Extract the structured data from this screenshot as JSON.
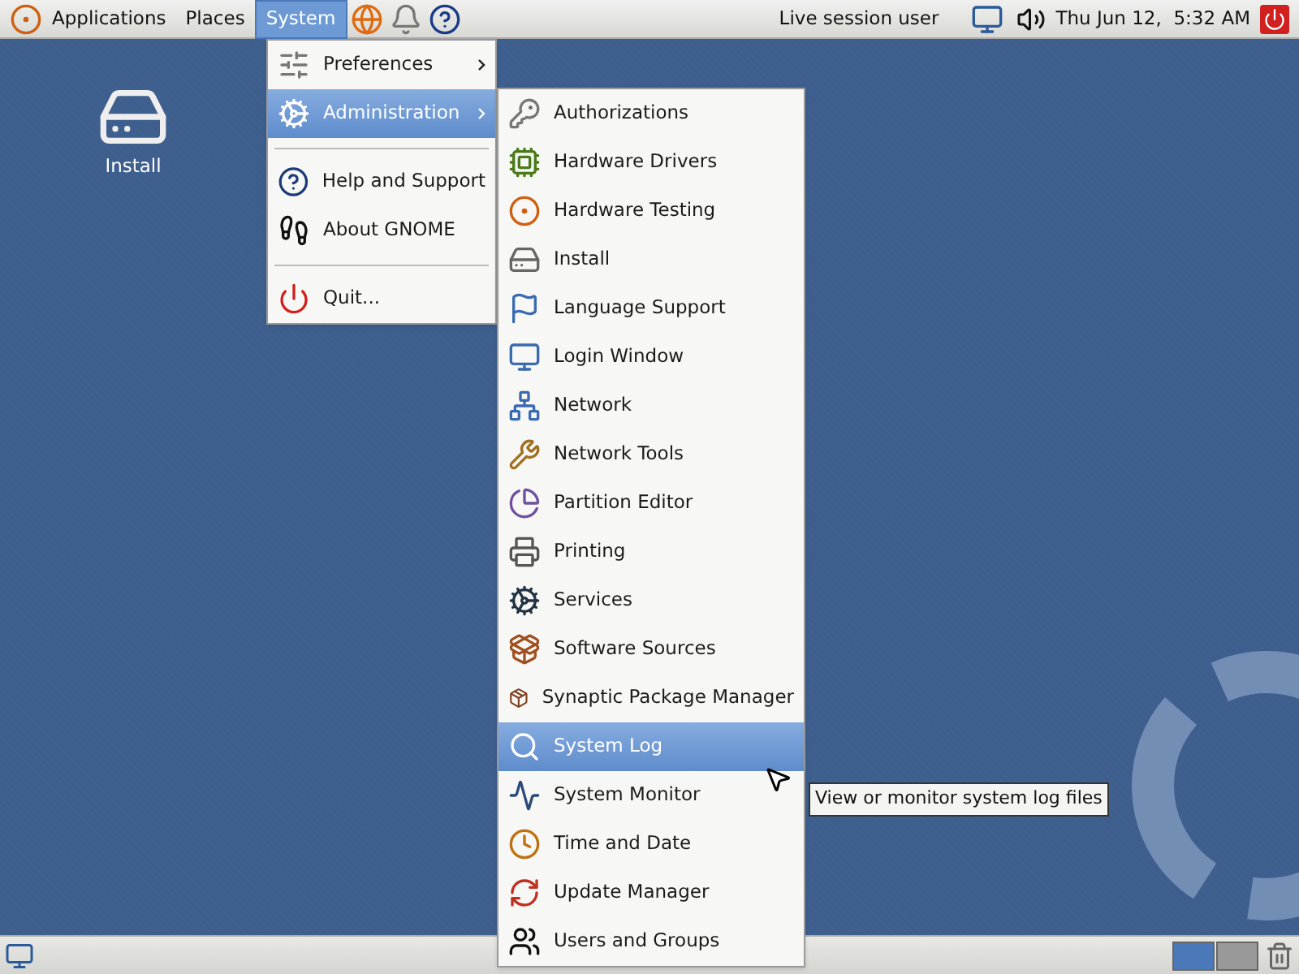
{
  "top_panel": {
    "menus": [
      {
        "label": "Applications",
        "selected": false
      },
      {
        "label": "Places",
        "selected": false
      },
      {
        "label": "System",
        "selected": true
      }
    ],
    "user": "Live session user",
    "clock": "Thu Jun 12,  5:32 AM"
  },
  "desktop_icons": [
    {
      "label": "Install"
    }
  ],
  "system_menu": [
    {
      "kind": "item",
      "label": "Preferences",
      "submenu": true,
      "selected": false
    },
    {
      "kind": "item",
      "label": "Administration",
      "submenu": true,
      "selected": true
    },
    {
      "kind": "separator"
    },
    {
      "kind": "item",
      "label": "Help and Support",
      "submenu": false,
      "selected": false
    },
    {
      "kind": "item",
      "label": "About GNOME",
      "submenu": false,
      "selected": false
    },
    {
      "kind": "separator"
    },
    {
      "kind": "item",
      "label": "Quit...",
      "submenu": false,
      "selected": false
    }
  ],
  "administration_menu": [
    {
      "label": "Authorizations",
      "selected": false
    },
    {
      "label": "Hardware Drivers",
      "selected": false
    },
    {
      "label": "Hardware Testing",
      "selected": false
    },
    {
      "label": "Install",
      "selected": false
    },
    {
      "label": "Language Support",
      "selected": false
    },
    {
      "label": "Login Window",
      "selected": false
    },
    {
      "label": "Network",
      "selected": false
    },
    {
      "label": "Network Tools",
      "selected": false
    },
    {
      "label": "Partition Editor",
      "selected": false
    },
    {
      "label": "Printing",
      "selected": false
    },
    {
      "label": "Services",
      "selected": false
    },
    {
      "label": "Software Sources",
      "selected": false
    },
    {
      "label": "Synaptic Package Manager",
      "selected": false
    },
    {
      "label": "System Log",
      "selected": true
    },
    {
      "label": "System Monitor",
      "selected": false
    },
    {
      "label": "Time and Date",
      "selected": false
    },
    {
      "label": "Update Manager",
      "selected": false
    },
    {
      "label": "Users and Groups",
      "selected": false
    }
  ],
  "tooltip": "View or monitor system log files"
}
